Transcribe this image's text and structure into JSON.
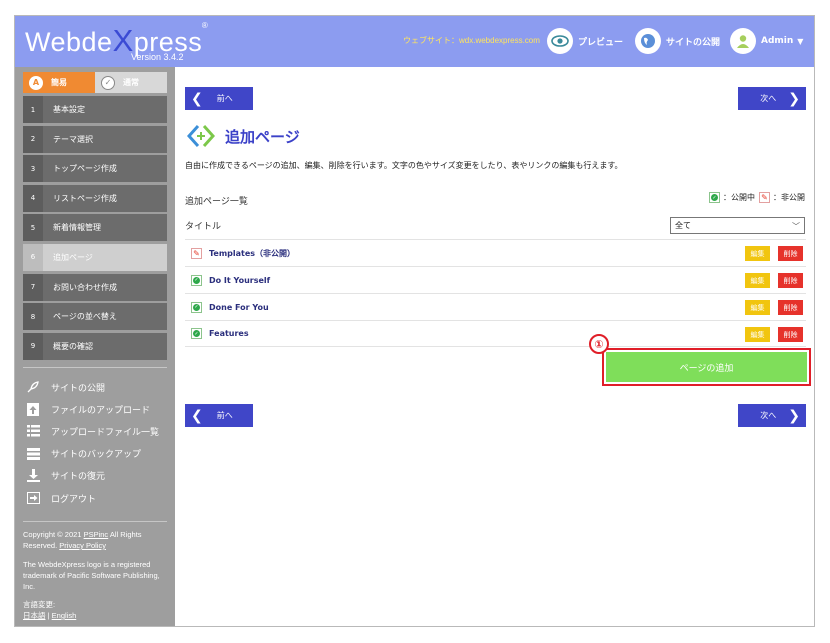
{
  "header": {
    "logo_part1": "Webde",
    "logo_x": "X",
    "logo_part2": "press",
    "logo_reg": "®",
    "version": "Version 3.4.2",
    "website": "ウェブサイト：wdx.webdexpress.com",
    "preview": "プレビュー",
    "publish": "サイトの公開",
    "user": "Admin"
  },
  "sidebar": {
    "modes": [
      {
        "label": "簡易",
        "icon": "A"
      },
      {
        "label": "通常",
        "icon": "✓"
      }
    ],
    "steps": [
      {
        "num": "1",
        "label": "基本設定"
      },
      {
        "num": "2",
        "label": "テーマ選択"
      },
      {
        "num": "3",
        "label": "トップページ作成"
      },
      {
        "num": "4",
        "label": "リストページ作成"
      },
      {
        "num": "5",
        "label": "新着情報管理"
      },
      {
        "num": "6",
        "label": "追加ページ"
      },
      {
        "num": "7",
        "label": "お問い合わせ作成"
      },
      {
        "num": "8",
        "label": "ページの並べ替え"
      },
      {
        "num": "9",
        "label": "概要の確認"
      }
    ],
    "tools": [
      {
        "label": "サイトの公開",
        "icon": "rocket-icon"
      },
      {
        "label": "ファイルのアップロード",
        "icon": "upload-icon"
      },
      {
        "label": "アップロードファイル一覧",
        "icon": "list-icon"
      },
      {
        "label": "サイトのバックアップ",
        "icon": "backup-icon"
      },
      {
        "label": "サイトの復元",
        "icon": "download-icon"
      },
      {
        "label": "ログアウト",
        "icon": "logout-icon"
      }
    ],
    "footer": {
      "copyright": "Copyright © 2021",
      "company": "PSPinc",
      "rights": "All Rights Reserved.",
      "privacy": "Privacy Policy",
      "trademark": "The WebdeXpress logo is a registered trademark of Pacific Software Publishing, Inc.",
      "lang_label": "言語変更:",
      "lang_ja": "日本語",
      "lang_sep": "|",
      "lang_en": "English"
    }
  },
  "main": {
    "prev": "前へ",
    "next": "次へ",
    "title": "追加ページ",
    "description": "自由に作成できるページの追加、編集、削除を行います。文字の色やサイズ変更をしたり、表やリンクの編集も行えます。",
    "list_label": "追加ページ一覧",
    "legend_published": "：公開中",
    "legend_private": "：非公開",
    "filter_label": "タイトル",
    "filter_value": "全て",
    "edit": "編集",
    "delete": "削除",
    "rows": [
      {
        "name": "Templates（非公開）",
        "status": "private"
      },
      {
        "name": "Do It Yourself",
        "status": "published"
      },
      {
        "name": "Done For You",
        "status": "published"
      },
      {
        "name": "Features",
        "status": "published"
      }
    ],
    "add_page": "ページの追加",
    "marker": "①"
  },
  "colors": {
    "header": "#8c9cf0",
    "accent": "#4046c8",
    "sidebar": "#9e9e9e",
    "add_button": "#7fde5a",
    "edit": "#f1c50f",
    "delete": "#e6322b",
    "highlight": "#e01e28"
  }
}
